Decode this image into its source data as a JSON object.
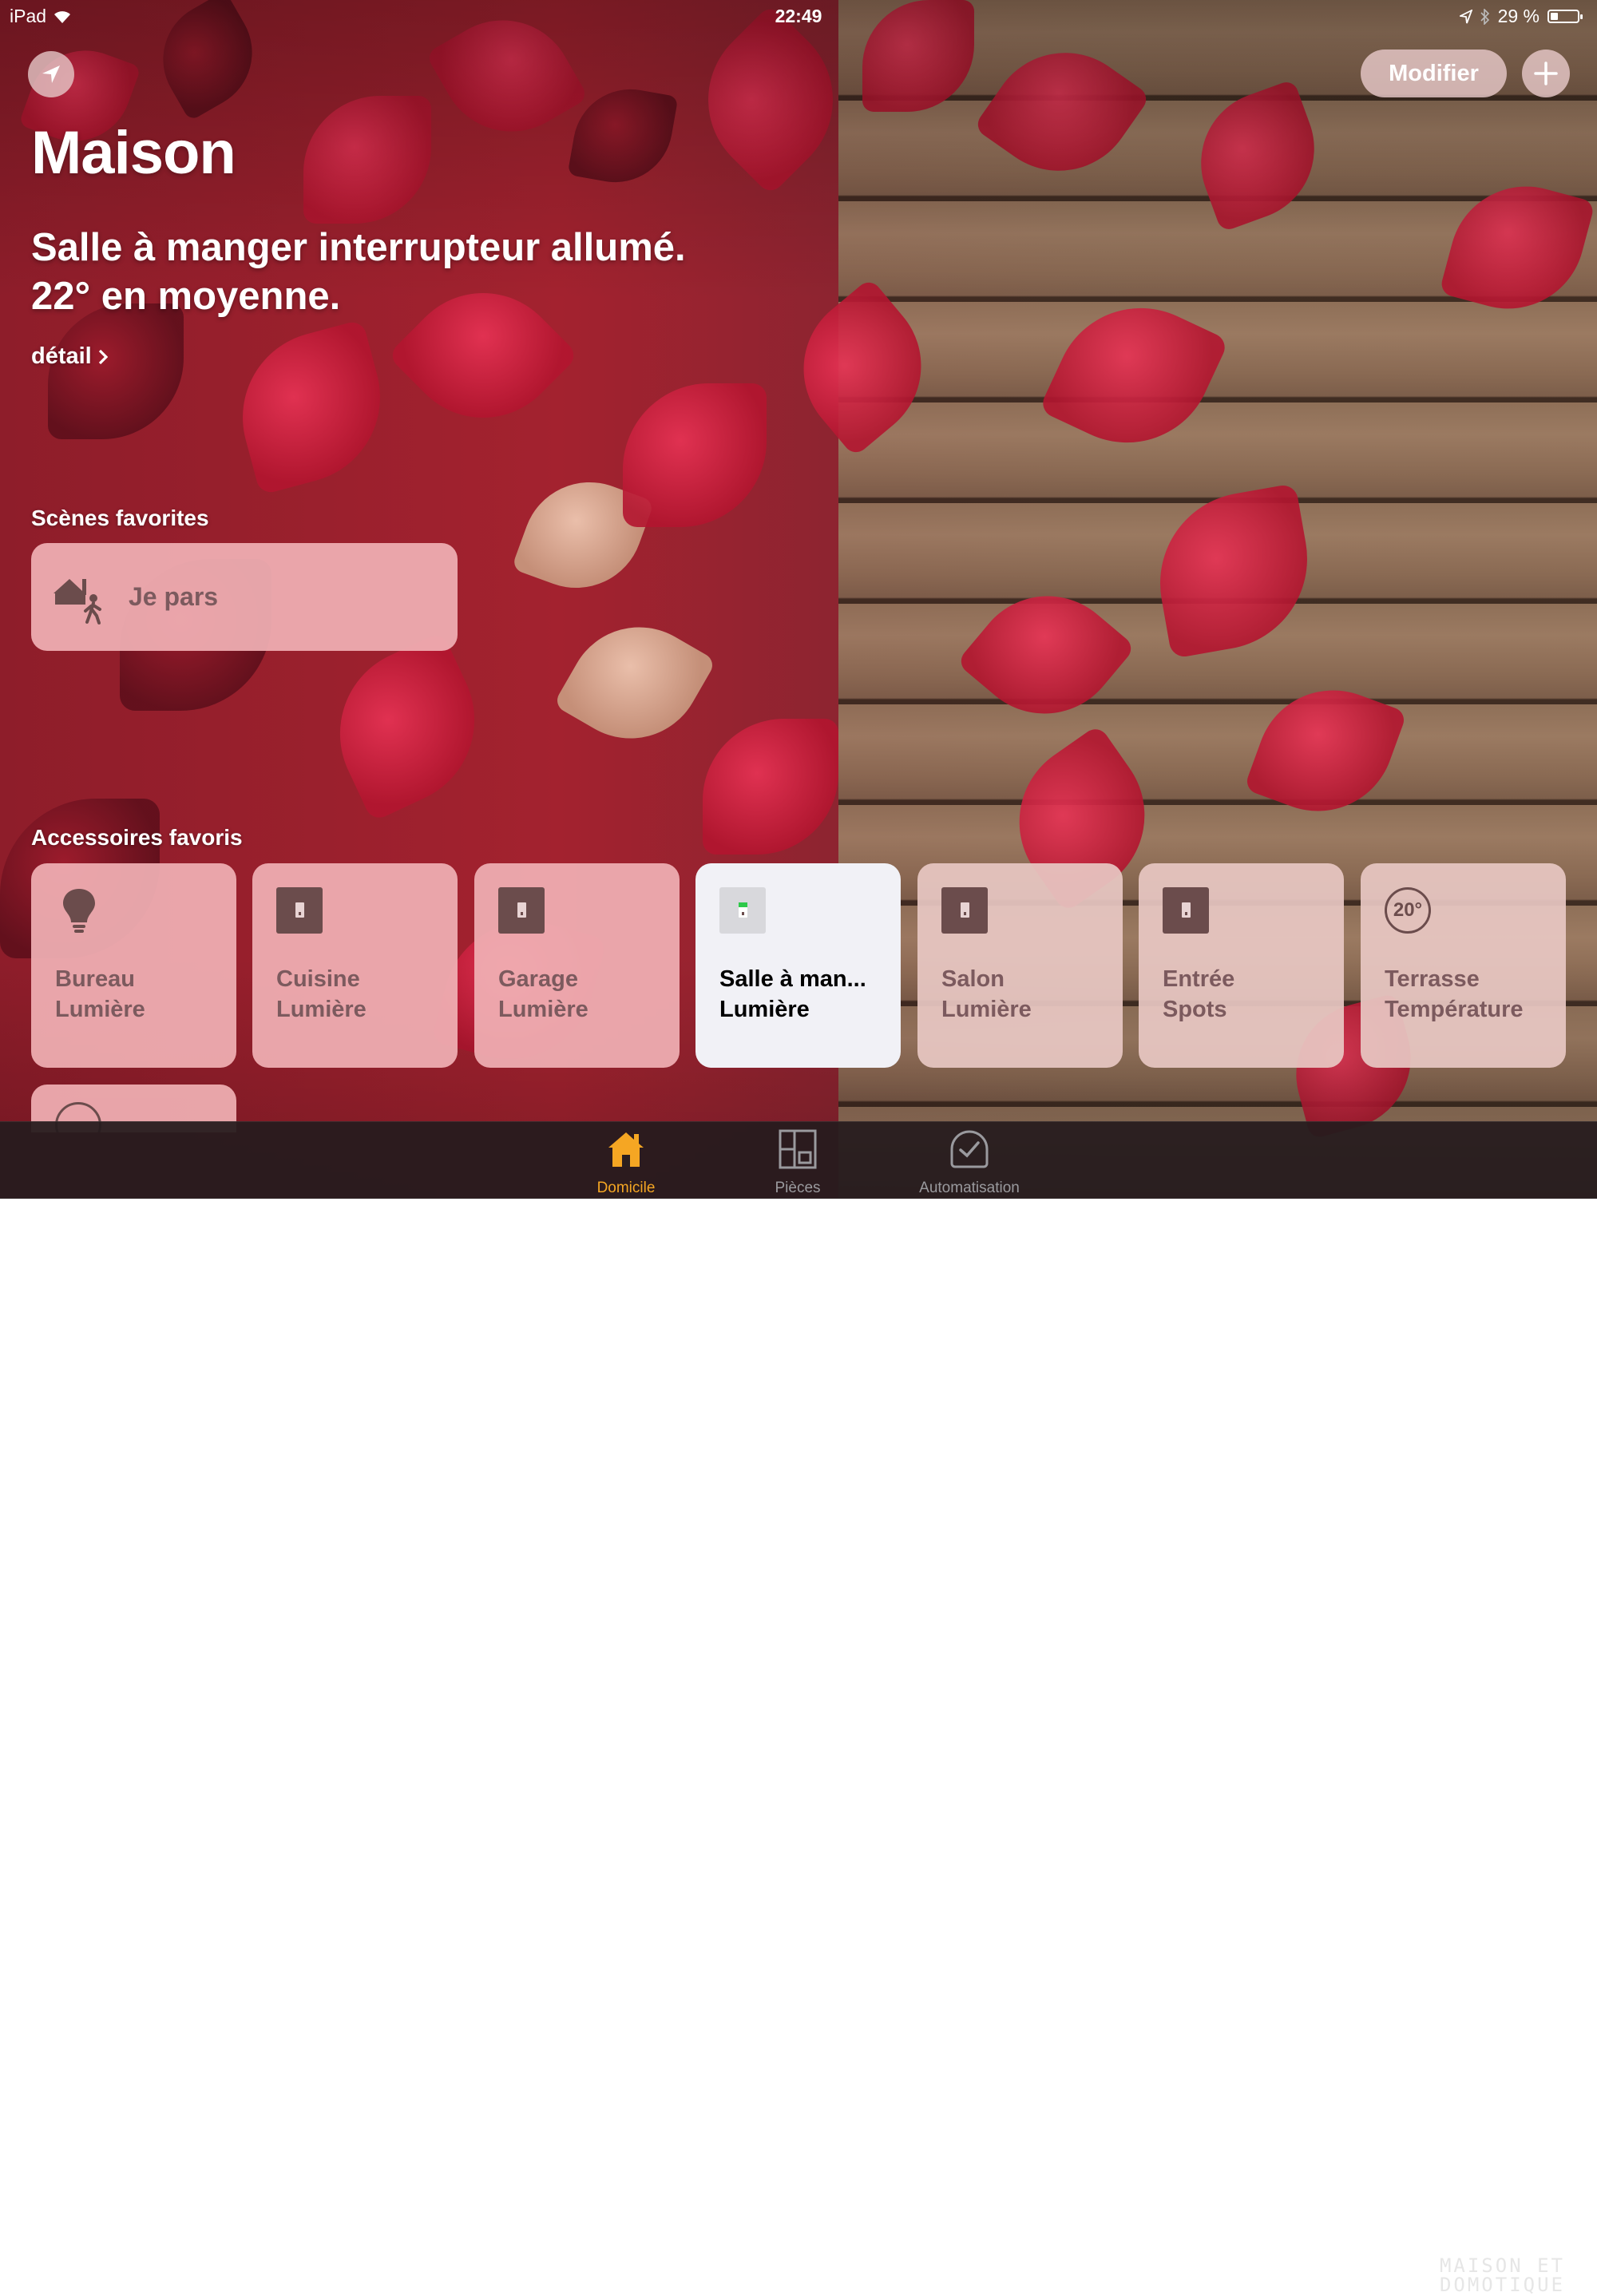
{
  "status_bar": {
    "device": "iPad",
    "time": "22:49",
    "battery": "29 %",
    "battery_level": 0.29
  },
  "header": {
    "modify_label": "Modifier",
    "title": "Maison",
    "summary_line1": "Salle à manger interrupteur allumé.",
    "summary_line2": "22° en moyenne.",
    "detail_label": "détail"
  },
  "scenes": {
    "section_title": "Scènes favorites",
    "items": [
      {
        "label": "Je pars",
        "icon": "leave-home-icon"
      }
    ]
  },
  "accessories": {
    "section_title": "Accessoires favoris",
    "items": [
      {
        "room": "Bureau",
        "name": "Lumière",
        "icon": "lightbulb-icon",
        "state": "off"
      },
      {
        "room": "Cuisine",
        "name": "Lumière",
        "icon": "switch-icon",
        "state": "off"
      },
      {
        "room": "Garage",
        "name": "Lumière",
        "icon": "switch-icon",
        "state": "off"
      },
      {
        "room": "Salle à man...",
        "name": "Lumière",
        "icon": "switch-icon",
        "state": "on"
      },
      {
        "room": "Salon",
        "name": "Lumière",
        "icon": "switch-icon",
        "state": "off"
      },
      {
        "room": "Entrée",
        "name": "Spots",
        "icon": "switch-icon",
        "state": "off"
      },
      {
        "room": "Terrasse",
        "name": "Température",
        "icon": "thermometer-icon",
        "value": "20°"
      }
    ]
  },
  "tabbar": {
    "tabs": [
      {
        "label": "Domicile",
        "icon": "home-icon",
        "active": true
      },
      {
        "label": "Pièces",
        "icon": "rooms-icon",
        "active": false
      },
      {
        "label": "Automatisation",
        "icon": "clock-icon",
        "active": false
      }
    ]
  },
  "watermark": {
    "line1": "MAISON ET",
    "line2": "DOMOTIQUE"
  },
  "colors": {
    "accent": "#f5a623",
    "tile": "#f0afb4",
    "tile_active": "#f1f1f6",
    "switch_on": "#2ec94a"
  }
}
